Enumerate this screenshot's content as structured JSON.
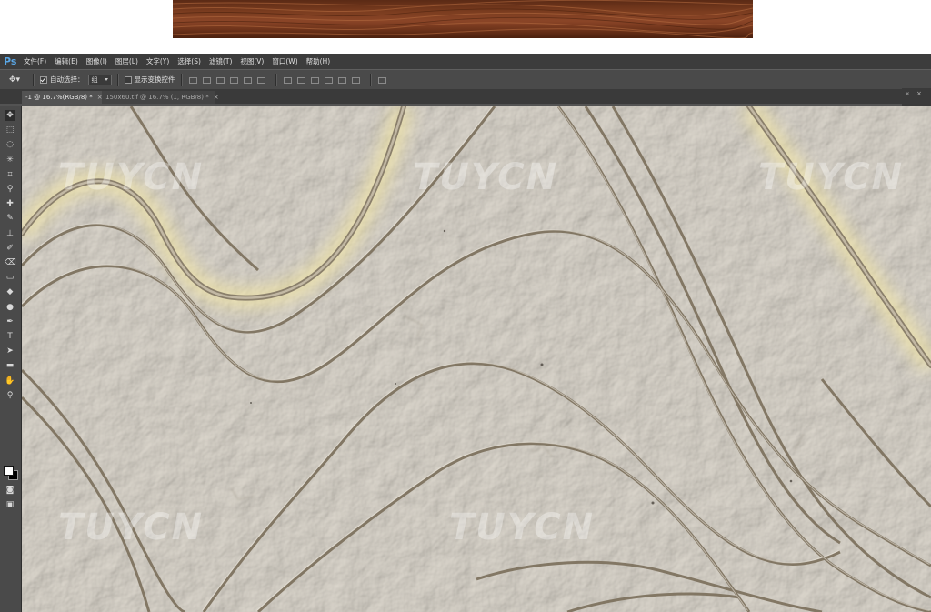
{
  "app": {
    "logo": "Ps",
    "menu": [
      "文件(F)",
      "编辑(E)",
      "图像(I)",
      "图层(L)",
      "文字(Y)",
      "选择(S)",
      "滤镜(T)",
      "视图(V)",
      "窗口(W)",
      "帮助(H)"
    ]
  },
  "options": {
    "tool_icon": "move-tool-icon",
    "auto_select_label": "自动选择：",
    "auto_select_checked": true,
    "auto_select_value": "组",
    "show_transform_label": "显示变换控件",
    "show_transform_checked": false
  },
  "tabs": [
    {
      "label": "-1 @ 16.7%(RGB/8) *",
      "active": true
    },
    {
      "label": "150x60.tif @ 16.7% (1, RGB/8) *",
      "active": false
    }
  ],
  "tab_close": "×",
  "tools": [
    "move-tool",
    "marquee-tool",
    "lasso-tool",
    "magic-wand-tool",
    "crop-tool",
    "eyedropper-tool",
    "healing-brush-tool",
    "brush-tool",
    "clone-stamp-tool",
    "history-brush-tool",
    "eraser-tool",
    "gradient-tool",
    "blur-tool",
    "dodge-tool",
    "pen-tool",
    "type-tool",
    "path-selection-tool",
    "shape-tool",
    "hand-tool",
    "zoom-tool"
  ],
  "tool_glyphs": [
    "✥",
    "⬚",
    "◌",
    "✳",
    "⌗",
    "⚲",
    "✚",
    "✎",
    "⊥",
    "✐",
    "⌫",
    "▭",
    "◆",
    "●",
    "✒",
    "T",
    "➤",
    "▬",
    "✋",
    "⚲"
  ],
  "colors": {
    "foreground": "#ffffff",
    "background": "#000000",
    "accent": "#5aa7e6"
  },
  "watermark": "TUYCN"
}
